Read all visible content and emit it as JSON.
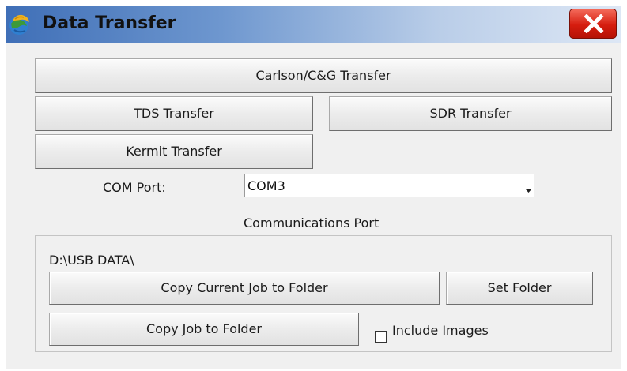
{
  "window": {
    "title": "Data Transfer",
    "app_icon": "globe-icon",
    "close_icon": "close-icon"
  },
  "buttons": {
    "carlson_transfer": "Carlson/C&G Transfer",
    "tds_transfer": "TDS Transfer",
    "sdr_transfer": "SDR Transfer",
    "kermit_transfer": "Kermit Transfer"
  },
  "com_port": {
    "label": "COM Port:",
    "value": "COM3",
    "caption": "Communications Port"
  },
  "folder_section": {
    "path": "D:\\USB DATA\\",
    "copy_current_job_label": "Copy Current Job to Folder",
    "set_folder_label": "Set Folder",
    "copy_job_label": "Copy Job to Folder",
    "include_images_label": "Include Images",
    "include_images_checked": false
  },
  "colors": {
    "titlebar_start": "#3f6fb7",
    "titlebar_end": "#dde7f5",
    "close_button": "#d61d0f",
    "window_background": "#f0f0f0"
  }
}
